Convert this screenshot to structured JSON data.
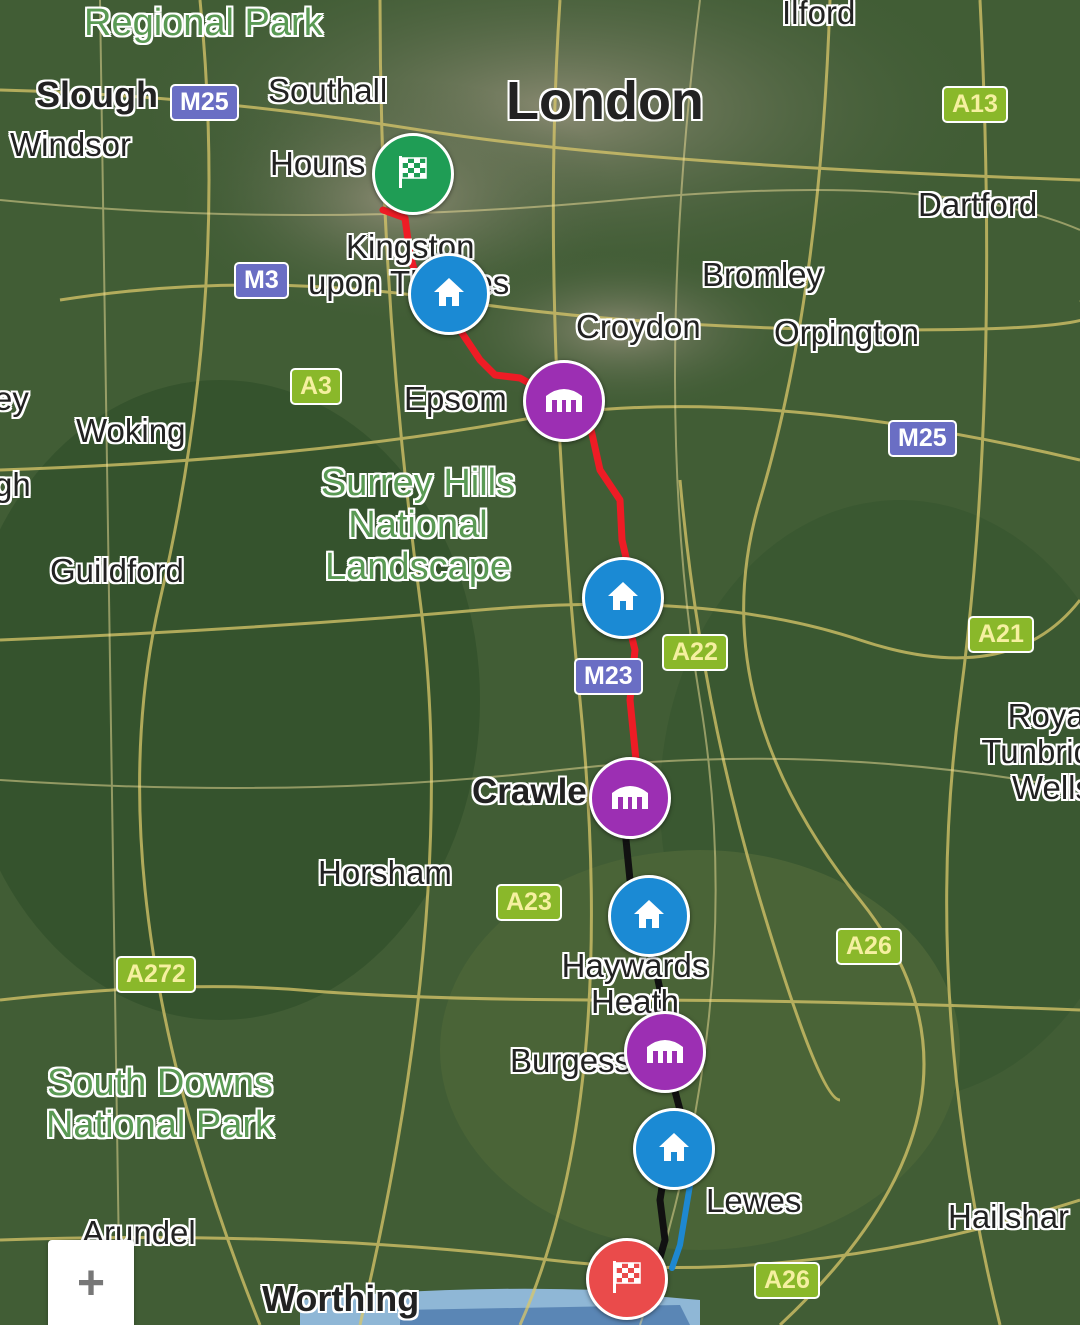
{
  "map": {
    "places": {
      "regional_park": "Regional Park",
      "ilford": "Ilford",
      "slough": "Slough",
      "southall": "Southall",
      "london": "London",
      "windsor": "Windsor",
      "hounslow": "Houns",
      "dartford": "Dartford",
      "kingston": "Kingston",
      "upon_thames": "upon Thames",
      "bromley": "Bromley",
      "croydon": "Croydon",
      "orpington": "Orpington",
      "epsom": "Epsom",
      "woking": "Woking",
      "left_edge_1": "ey",
      "left_edge_2": "gh",
      "guildford": "Guildford",
      "crawley": "Crawle",
      "royal_tunbridge": "Royal Tunbrid Wells",
      "horsham": "Horsham",
      "haywards_heath": "Haywards Heath",
      "burgess_hill": "Burgess",
      "lewes": "Lewes",
      "hailsham": "Hailshar",
      "arundel": "Arundel",
      "worthing": "Worthing"
    },
    "parks": {
      "surrey_hills": "Surrey Hills National Landscape",
      "south_downs": "South Downs National Park"
    },
    "roads": {
      "m25_west": "M25",
      "a13": "A13",
      "m3": "M3",
      "a3": "A3",
      "m25_east": "M25",
      "a22": "A22",
      "m23": "M23",
      "a21": "A21",
      "a23": "A23",
      "a26_north": "A26",
      "a272": "A272",
      "a26_south": "A26"
    },
    "markers": {
      "start": "start-flag-icon",
      "finish": "finish-flag-icon",
      "home": "home-icon",
      "stop": "hotel-icon"
    },
    "route_colors": {
      "leg1": "#ee1c25",
      "leg2": "#111111",
      "leg3": "#1e88d0"
    },
    "zoom_in_label": "+"
  }
}
